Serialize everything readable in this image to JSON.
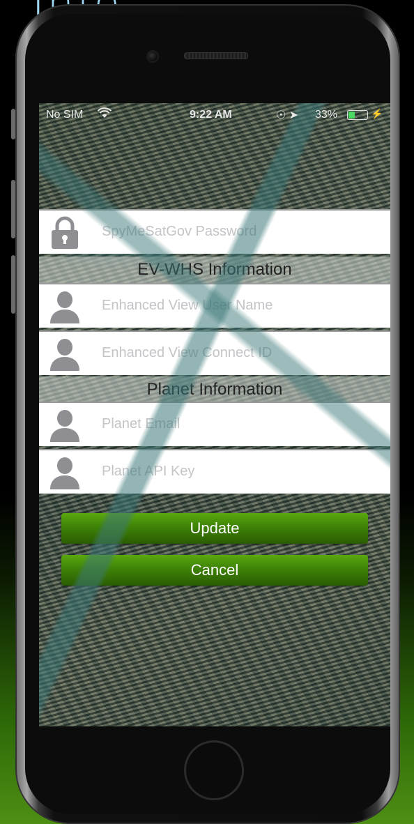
{
  "page_heading": "Info",
  "status_bar": {
    "carrier": "No SIM",
    "time": "9:22 AM",
    "battery": "33%"
  },
  "form": {
    "spymesatgov_password_placeholder": "SpyMeSatGov Password",
    "ev_whs_section": "EV-WHS Information",
    "ev_username_placeholder": "Enhanced View User Name",
    "ev_connect_id_placeholder": "Enhanced View Connect ID",
    "planet_section": "Planet Information",
    "planet_email_placeholder": "Planet Email",
    "planet_api_key_placeholder": "Planet API Key"
  },
  "buttons": {
    "update": "Update",
    "cancel": "Cancel"
  },
  "colors": {
    "button_green": "#3e8207",
    "icon_gray": "#8e8e93",
    "heading_blue": "#9fd6f2"
  },
  "icons": [
    "lock-icon",
    "person-icon",
    "wifi-icon",
    "location-icon",
    "battery-icon"
  ]
}
